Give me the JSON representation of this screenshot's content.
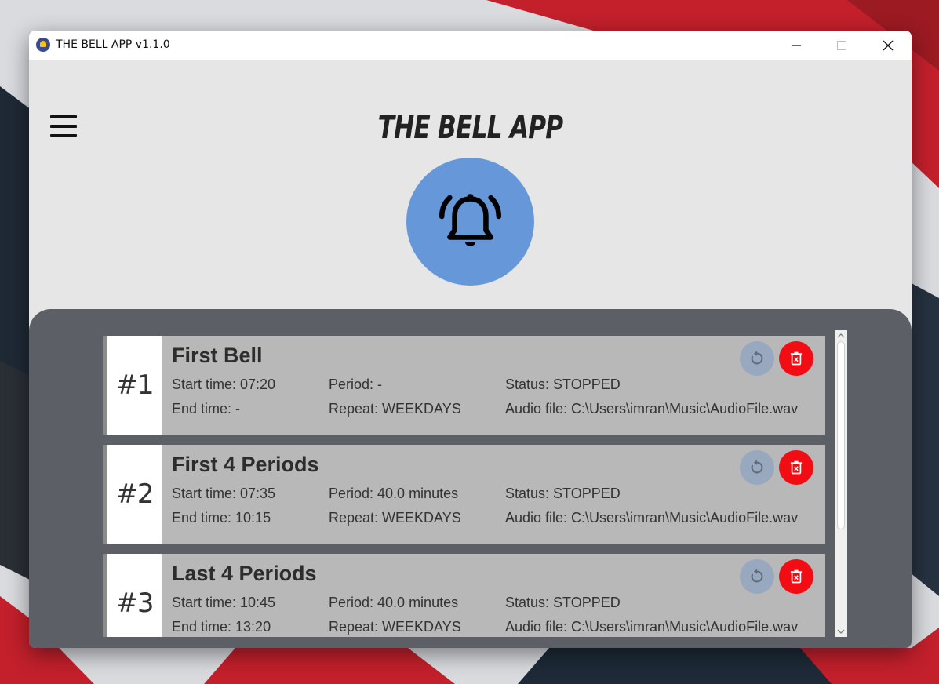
{
  "window": {
    "title": "THE BELL APP v1.1.0"
  },
  "header": {
    "app_title": "THE BELL APP"
  },
  "colors": {
    "accent_circle": "#6698d9",
    "panel_background": "#5c6066",
    "card_background": "#b8b8b8",
    "delete_button": "#f20d14",
    "reset_button": "#98a8be"
  },
  "icons": {
    "menu": "hamburger-menu-icon",
    "bell": "ringing-bell-icon",
    "reset": "reset-icon",
    "delete": "trash-icon"
  },
  "bells": [
    {
      "number": "#1",
      "name": "First Bell",
      "start_time": "Start time: 07:20",
      "end_time": "End time: -",
      "period": "Period: -",
      "repeat": "Repeat: WEEKDAYS",
      "status": "Status: STOPPED",
      "audio_file": "Audio file: C:\\Users\\imran\\Music\\AudioFile.wav"
    },
    {
      "number": "#2",
      "name": "First 4 Periods",
      "start_time": "Start time: 07:35",
      "end_time": "End time: 10:15",
      "period": "Period: 40.0 minutes",
      "repeat": "Repeat: WEEKDAYS",
      "status": "Status: STOPPED",
      "audio_file": "Audio file: C:\\Users\\imran\\Music\\AudioFile.wav"
    },
    {
      "number": "#3",
      "name": "Last 4 Periods",
      "start_time": "Start time: 10:45",
      "end_time": "End time: 13:20",
      "period": "Period: 40.0 minutes",
      "repeat": "Repeat: WEEKDAYS",
      "status": "Status: STOPPED",
      "audio_file": "Audio file: C:\\Users\\imran\\Music\\AudioFile.wav"
    }
  ]
}
